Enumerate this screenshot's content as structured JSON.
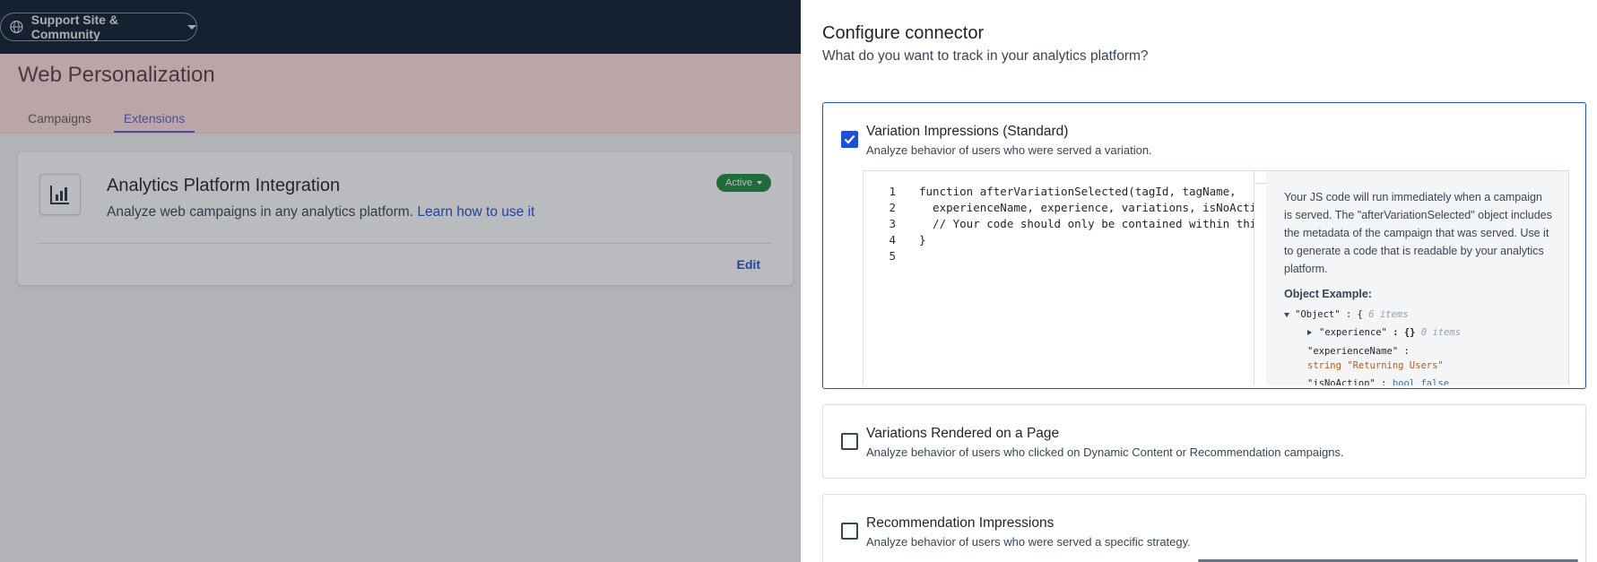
{
  "topbar": {
    "site_label": "Support Site & Community"
  },
  "page": {
    "title": "Web Personalization",
    "tabs": [
      {
        "label": "Campaigns"
      },
      {
        "label": "Extensions"
      }
    ]
  },
  "extension_card": {
    "title": "Analytics Platform Integration",
    "description": "Analyze web campaigns in any analytics platform.",
    "link_text": "Learn how to use it",
    "status": "Active",
    "edit_label": "Edit"
  },
  "drawer": {
    "title": "Configure connector",
    "subtitle": "What do you want to track in your analytics platform?",
    "options": [
      {
        "title": "Variation Impressions (Standard)",
        "description": "Analyze behavior of users who were served a variation.",
        "checked": true
      },
      {
        "title": "Variations Rendered on a Page",
        "description": "Analyze behavior of users who clicked on Dynamic Content or Recommendation campaigns.",
        "checked": false
      },
      {
        "title": "Recommendation Impressions",
        "description": "Analyze behavior of users who were served a specific strategy.",
        "checked": false
      }
    ],
    "code_lines": [
      {
        "num": "1",
        "text": "function afterVariationSelected(tagId, tagName,"
      },
      {
        "num": "2",
        "text": "  experienceName, experience, variations, isNoAction) {"
      },
      {
        "num": "3",
        "text": "  // Your code should only be contained within this function"
      },
      {
        "num": "4",
        "text": "}"
      },
      {
        "num": "5",
        "text": ""
      }
    ],
    "help_text": "Your JS code will run immediately when a campaign is served. The \"afterVariationSelected\" object includes the metadata of the campaign that was served. Use it to generate a code that is readable by your analytics platform.",
    "example_label": "Object Example:",
    "object_tree": {
      "root_key": "\"Object\"",
      "root_open": ": {",
      "root_count": "6 items",
      "experience_key": "\"experience\"",
      "experience_val": ": {}",
      "experience_count": "0 items",
      "experience_name_key": "\"experienceName\" :",
      "experience_name_type": "string",
      "experience_name_val": "\"Returning Users\"",
      "is_no_action_key": "\"isNoAction\" :",
      "is_no_action_type": "bool",
      "is_no_action_val": "false"
    }
  }
}
